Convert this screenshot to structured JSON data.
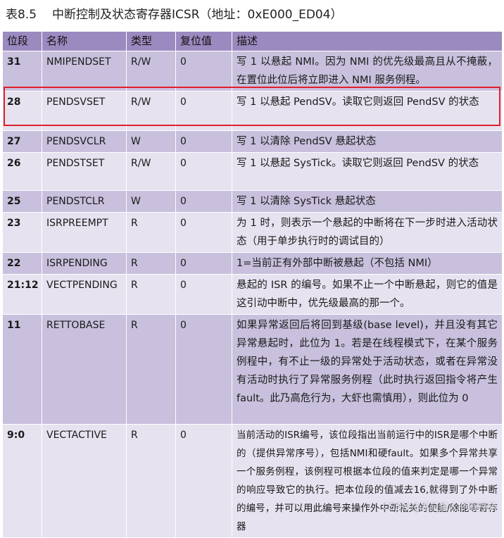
{
  "caption": {
    "number": "表8.5",
    "title": "中断控制及状态寄存器ICSR（地址：0xE000_ED04）"
  },
  "table": {
    "headers": [
      "位段",
      "名称",
      "类型",
      "复位值",
      "描述"
    ],
    "rows": [
      {
        "bit": "31",
        "name": "NMIPENDSET",
        "type": "R/W",
        "reset": "0",
        "desc": "写 1 以悬起 NMI。因为 NMI 的优先级最高且从不掩蔽，在置位此位后将立即进入 NMI 服务例程。"
      },
      {
        "bit": "28",
        "name": "PENDSVSET",
        "type": "R/W",
        "reset": "0",
        "desc": "写 1 以悬起 PendSV。读取它则返回 PendSV 的状态"
      },
      {
        "bit": "27",
        "name": "PENDSVCLR",
        "type": "W",
        "reset": "0",
        "desc": "写 1 以清除 PendSV 悬起状态"
      },
      {
        "bit": "26",
        "name": "PENDSTSET",
        "type": "R/W",
        "reset": "0",
        "desc": "写 1 以悬起 SysTick。读取它则返回 PendSV 的状态"
      },
      {
        "bit": "25",
        "name": "PENDSTCLR",
        "type": "W",
        "reset": "0",
        "desc": "写 1 以清除 SysTick 悬起状态"
      },
      {
        "bit": "23",
        "name": "ISRPREEMPT",
        "type": "R",
        "reset": "0",
        "desc": "为 1 时，则表示一个悬起的中断将在下一步时进入活动状态（用于单步执行时的调试目的）"
      },
      {
        "bit": "22",
        "name": "ISRPENDING",
        "type": "R",
        "reset": "0",
        "desc": "1=当前正有外部中断被悬起（不包括 NMI）"
      },
      {
        "bit": "21:12",
        "name": "VECTPENDING",
        "type": "R",
        "reset": "0",
        "desc": "悬起的 ISR 的编号。如果不止一个中断悬起，则它的值是这引动中断中，优先级最高的那一个。"
      },
      {
        "bit": "11",
        "name": "RETTOBASE",
        "type": "R",
        "reset": "0",
        "desc": "如果异常返回后将回到基级(base level)，并且没有其它异常悬起时，此位为 1。若是在线程模式下，在某个服务例程中，有不止一级的异常处于活动状态，或者在异常没有活动时执行了异常服务例程（此时执行返回指令将产生 fault。此乃高危行为，大虾也需慎用），则此位为 0"
      },
      {
        "bit": "9:0",
        "name": "VECTACTIVE",
        "type": "R",
        "reset": "0",
        "desc": "当前活动的ISR编号，该位段指出当前运行中的ISR是哪个中断的（提供异常序号），包括NMI和硬fault。如果多个异常共享一个服务例程，该例程可根据本位段的值来判定是哪一个异常的响应导致它的执行。把本位段的值减去16,就得到了外中断的编号，并可以用此编号来操作外中断相关的使能/除能等寄存器"
      }
    ]
  },
  "watermark": "CSDN @寒星懦人.的程序猿",
  "colors": {
    "header": "#9b8ac0",
    "row_dark": "#c9c0dd",
    "row_light": "#e6e2ef",
    "highlight": "#e0202a"
  }
}
